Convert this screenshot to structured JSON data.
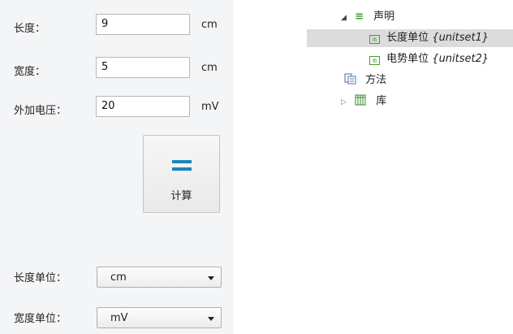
{
  "form": {
    "length_label": "长度：",
    "length_value": "9",
    "length_unit": "cm",
    "width_label": "宽度：",
    "width_value": "5",
    "width_unit": "cm",
    "voltage_label": "外加电压：",
    "voltage_value": "20",
    "voltage_unit": "mV",
    "calc_label": "计算",
    "length_unit_label": "长度单位：",
    "length_unit_select": "cm",
    "width_unit_label": "宽度单位：",
    "width_unit_select": "mV"
  },
  "tree": {
    "declarations_label": "声明",
    "items": [
      {
        "label": "长度单位",
        "tag": "{unitset1}"
      },
      {
        "label": "电势单位",
        "tag": "{unitset2}"
      }
    ],
    "methods_label": "方法",
    "library_label": "库"
  },
  "colors": {
    "accent": "#1a86b8",
    "unit_icon": "#4a9a2c",
    "selected_row": "#dcdcdc",
    "panel_bg": "#f4f5f7"
  }
}
